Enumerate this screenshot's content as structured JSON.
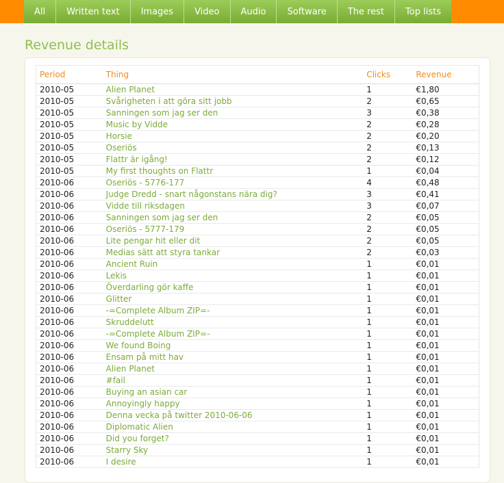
{
  "nav": {
    "tabs": [
      {
        "label": "All"
      },
      {
        "label": "Written text"
      },
      {
        "label": "Images"
      },
      {
        "label": "Video"
      },
      {
        "label": "Audio"
      },
      {
        "label": "Software"
      },
      {
        "label": "The rest"
      },
      {
        "label": "Top lists"
      }
    ]
  },
  "page": {
    "title": "Revenue details"
  },
  "colors": {
    "header_bar": "#ff8c00",
    "tab_green": "#8cbf47",
    "link_green": "#7aab37",
    "column_header_orange": "#f08c1a"
  },
  "table": {
    "headers": {
      "period": "Period",
      "thing": "Thing",
      "clicks": "Clicks",
      "revenue": "Revenue"
    },
    "rows": [
      {
        "period": "2010-05",
        "thing": "Alien Planet",
        "clicks": "1",
        "revenue": "€1,80"
      },
      {
        "period": "2010-05",
        "thing": "Svårigheten i att göra sitt jobb",
        "clicks": "2",
        "revenue": "€0,65"
      },
      {
        "period": "2010-05",
        "thing": "Sanningen som jag ser den",
        "clicks": "3",
        "revenue": "€0,38"
      },
      {
        "period": "2010-05",
        "thing": "Music by Vidde",
        "clicks": "2",
        "revenue": "€0,28"
      },
      {
        "period": "2010-05",
        "thing": "Horsie",
        "clicks": "2",
        "revenue": "€0,20"
      },
      {
        "period": "2010-05",
        "thing": "Oseriös",
        "clicks": "2",
        "revenue": "€0,13"
      },
      {
        "period": "2010-05",
        "thing": "Flattr är igång!",
        "clicks": "2",
        "revenue": "€0,12"
      },
      {
        "period": "2010-05",
        "thing": "My first thoughts on Flattr",
        "clicks": "1",
        "revenue": "€0,04"
      },
      {
        "period": "2010-06",
        "thing": "Oseriös - 5776-177",
        "clicks": "4",
        "revenue": "€0,48"
      },
      {
        "period": "2010-06",
        "thing": "Judge Dredd - snart någonstans nära dig?",
        "clicks": "3",
        "revenue": "€0,41"
      },
      {
        "period": "2010-06",
        "thing": "Vidde till riksdagen",
        "clicks": "3",
        "revenue": "€0,07"
      },
      {
        "period": "2010-06",
        "thing": "Sanningen som jag ser den",
        "clicks": "2",
        "revenue": "€0,05"
      },
      {
        "period": "2010-06",
        "thing": "Oseriös - 5777-179",
        "clicks": "2",
        "revenue": "€0,05"
      },
      {
        "period": "2010-06",
        "thing": "Lite pengar hit eller dit",
        "clicks": "2",
        "revenue": "€0,05"
      },
      {
        "period": "2010-06",
        "thing": "Medias sätt att styra tankar",
        "clicks": "2",
        "revenue": "€0,03"
      },
      {
        "period": "2010-06",
        "thing": "Ancient Ruin",
        "clicks": "1",
        "revenue": "€0,01"
      },
      {
        "period": "2010-06",
        "thing": "Lekis",
        "clicks": "1",
        "revenue": "€0,01"
      },
      {
        "period": "2010-06",
        "thing": "Överdarling gör kaffe",
        "clicks": "1",
        "revenue": "€0,01"
      },
      {
        "period": "2010-06",
        "thing": "Glitter",
        "clicks": "1",
        "revenue": "€0,01"
      },
      {
        "period": "2010-06",
        "thing": "-=Complete Album ZIP=-",
        "clicks": "1",
        "revenue": "€0,01"
      },
      {
        "period": "2010-06",
        "thing": "Skruddelutt",
        "clicks": "1",
        "revenue": "€0,01"
      },
      {
        "period": "2010-06",
        "thing": "-=Complete Album ZIP=-",
        "clicks": "1",
        "revenue": "€0,01"
      },
      {
        "period": "2010-06",
        "thing": "We found Boing",
        "clicks": "1",
        "revenue": "€0,01"
      },
      {
        "period": "2010-06",
        "thing": "Ensam på mitt hav",
        "clicks": "1",
        "revenue": "€0,01"
      },
      {
        "period": "2010-06",
        "thing": "Alien Planet",
        "clicks": "1",
        "revenue": "€0,01"
      },
      {
        "period": "2010-06",
        "thing": "#fail",
        "clicks": "1",
        "revenue": "€0,01"
      },
      {
        "period": "2010-06",
        "thing": "Buying an asian car",
        "clicks": "1",
        "revenue": "€0,01"
      },
      {
        "period": "2010-06",
        "thing": "Annoyingly happy",
        "clicks": "1",
        "revenue": "€0,01"
      },
      {
        "period": "2010-06",
        "thing": "Denna vecka på twitter 2010-06-06",
        "clicks": "1",
        "revenue": "€0,01"
      },
      {
        "period": "2010-06",
        "thing": "Diplomatic Alien",
        "clicks": "1",
        "revenue": "€0,01"
      },
      {
        "period": "2010-06",
        "thing": "Did you forget?",
        "clicks": "1",
        "revenue": "€0,01"
      },
      {
        "period": "2010-06",
        "thing": "Starry Sky",
        "clicks": "1",
        "revenue": "€0,01"
      },
      {
        "period": "2010-06",
        "thing": "I desire",
        "clicks": "1",
        "revenue": "€0,01"
      }
    ]
  }
}
